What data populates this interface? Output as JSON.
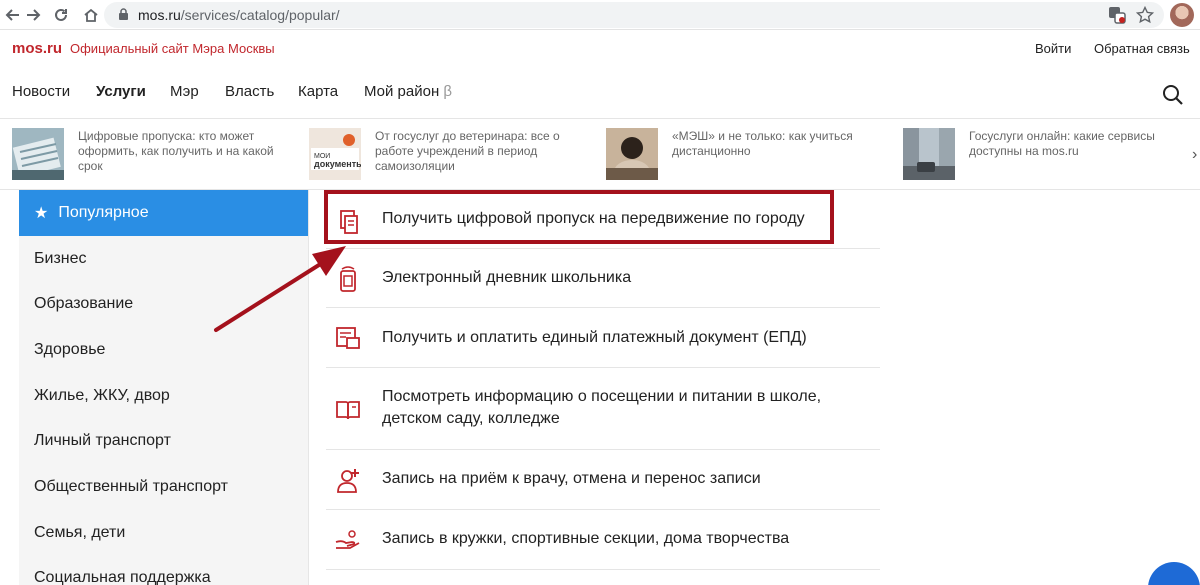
{
  "browser": {
    "url_host": "mos.ru",
    "url_path": "/services/catalog/popular/"
  },
  "site": {
    "logo": "mos.ru",
    "slogan": "Официальный сайт Мэра Москвы",
    "login": "Войти",
    "feedback": "Обратная связь"
  },
  "nav": {
    "items": [
      "Новости",
      "Услуги",
      "Мэр",
      "Власть",
      "Карта",
      "Мой район"
    ],
    "beta": "β",
    "active": "Услуги"
  },
  "news": [
    {
      "text": "Цифровые пропуска: кто может оформить, как получить и на какой срок"
    },
    {
      "text": "От госуслуг до ветеринара: все о работе учреждений в период самоизоляции"
    },
    {
      "text": "«МЭШ» и не только: как учиться дистанционно"
    },
    {
      "text": "Госуслуги онлайн: какие сервисы доступны на mos.ru"
    }
  ],
  "sidebar": {
    "items": [
      {
        "label": "Популярное"
      },
      {
        "label": "Бизнес"
      },
      {
        "label": "Образование"
      },
      {
        "label": "Здоровье"
      },
      {
        "label": "Жилье, ЖКУ, двор"
      },
      {
        "label": "Личный транспорт"
      },
      {
        "label": "Общественный транспорт"
      },
      {
        "label": "Семья, дети"
      },
      {
        "label": "Социальная поддержка"
      }
    ]
  },
  "services": [
    {
      "label": "Получить цифровой пропуск на передвижение по городу",
      "icon": "document-pass-icon"
    },
    {
      "label": "Электронный дневник школьника",
      "icon": "school-diary-icon"
    },
    {
      "label": "Получить и оплатить единый платежный документ (ЕПД)",
      "icon": "payment-document-icon"
    },
    {
      "label": "Посмотреть информацию о посещении и питании в школе, детском саду, колледже",
      "icon": "open-book-icon"
    },
    {
      "label": "Запись на приём к врачу, отмена и перенос записи",
      "icon": "doctor-icon"
    },
    {
      "label": "Запись в кружки, спортивные секции, дома творчества",
      "icon": "hands-icon"
    }
  ],
  "colors": {
    "brand_red": "#c1272d",
    "active_blue": "#2a8ee4",
    "highlight_red": "#a4111c"
  }
}
